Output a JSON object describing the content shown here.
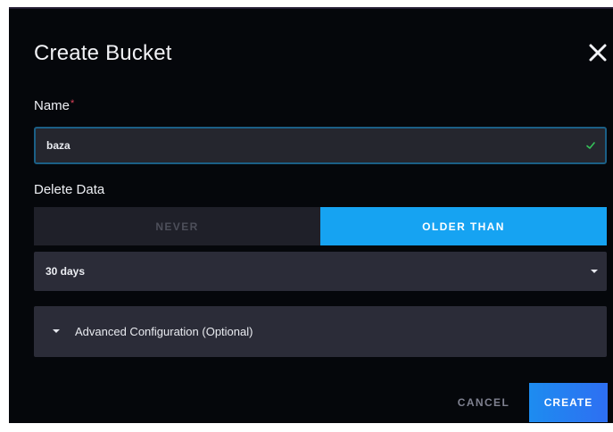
{
  "dialog": {
    "title": "Create Bucket",
    "close_icon": "close-icon"
  },
  "name_field": {
    "label": "Name",
    "required_mark": "*",
    "value": "baza",
    "valid_icon": "check-icon"
  },
  "delete_data": {
    "label": "Delete Data",
    "options": [
      "NEVER",
      "OLDER THAN"
    ],
    "selected": "OLDER THAN"
  },
  "retention_select": {
    "value": "30 days",
    "icon": "caret-down-icon"
  },
  "advanced": {
    "label": "Advanced Configuration (Optional)",
    "icon": "caret-down-icon",
    "expanded": false
  },
  "footer": {
    "cancel_label": "CANCEL",
    "create_label": "CREATE"
  },
  "colors": {
    "background": "#05070b",
    "accent": "#16a3f2",
    "input_border": "#1b5f86",
    "required": "#e0435b",
    "valid": "#35c35a"
  }
}
